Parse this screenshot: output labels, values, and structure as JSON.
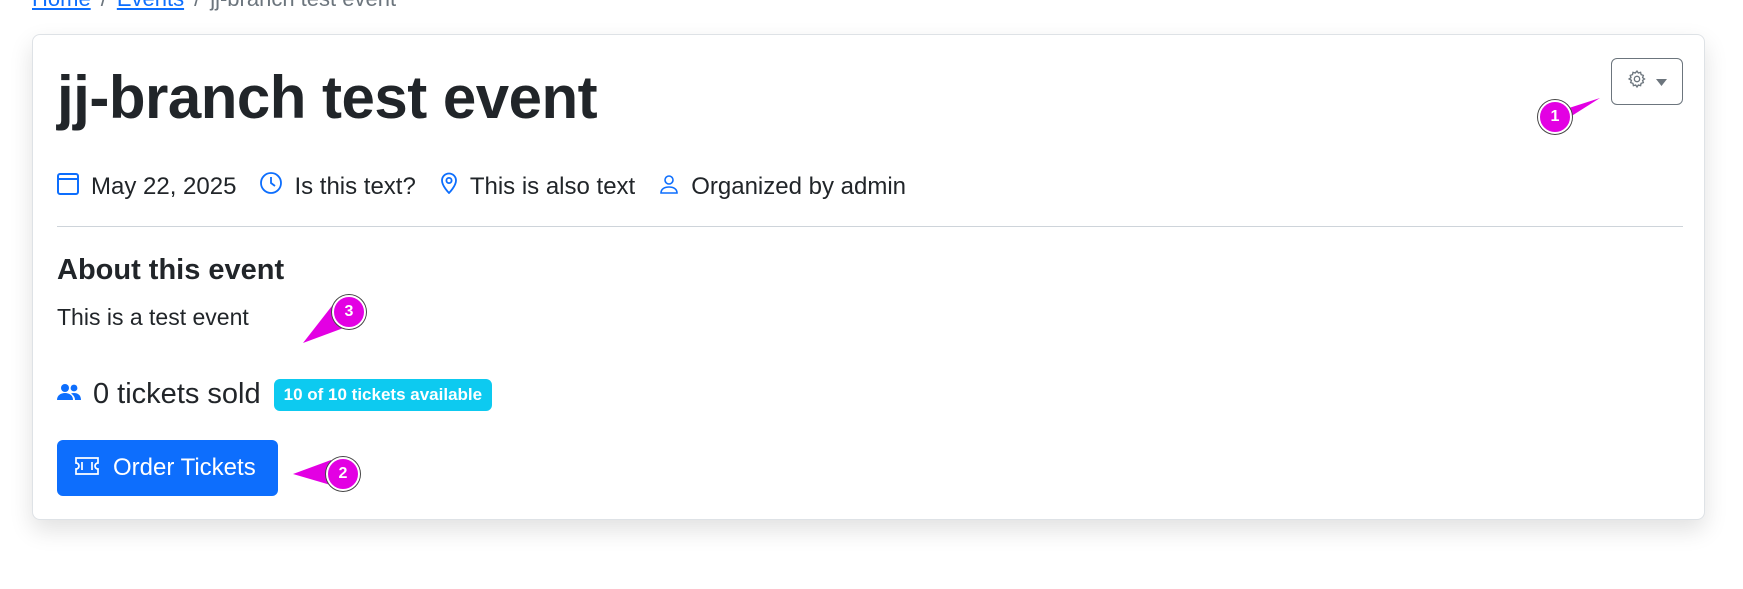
{
  "breadcrumb": {
    "items": [
      "Home",
      "Events",
      "jj-branch test event"
    ],
    "separator": "/"
  },
  "event": {
    "title": "jj-branch test event",
    "date": "May 22, 2025",
    "time": "Is this text?",
    "location": "This is also text",
    "organizer": "Organized by admin",
    "about_heading": "About this event",
    "description": "This is a test event",
    "tickets_sold": "0 tickets sold",
    "availability_badge": "10 of 10 tickets available",
    "order_button_label": "Order Tickets"
  },
  "icons": {
    "settings": "gear-icon",
    "settings_caret": "caret-down-icon",
    "date": "calendar-icon",
    "time": "clock-icon",
    "location": "map-pin-icon",
    "organizer": "person-icon",
    "tickets": "people-icon",
    "order": "ticket-icon"
  },
  "annotations": {
    "markers": [
      "1",
      "2",
      "3"
    ]
  },
  "colors": {
    "primary": "#0d6efd",
    "info_badge": "#0dcaf0",
    "text": "#212529",
    "annotation": "#e300e3"
  }
}
